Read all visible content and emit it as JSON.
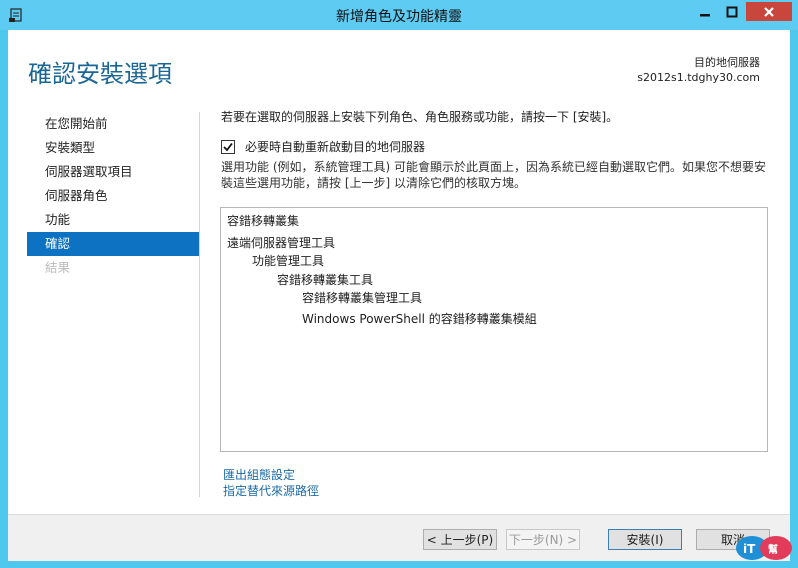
{
  "window": {
    "title": "新增角色及功能精靈"
  },
  "header": {
    "page_title": "確認安裝選項",
    "dest_label": "目的地伺服器",
    "dest_server": "s2012s1.tdghy30.com"
  },
  "sidebar": {
    "items": [
      {
        "label": "在您開始前"
      },
      {
        "label": "安裝類型"
      },
      {
        "label": "伺服器選取項目"
      },
      {
        "label": "伺服器角色"
      },
      {
        "label": "功能"
      },
      {
        "label": "確認"
      },
      {
        "label": "結果"
      }
    ]
  },
  "main": {
    "intro": "若要在選取的伺服器上安裝下列角色、角色服務或功能，請按一下 [安裝]。",
    "restart_label": "必要時自動重新啟動目的地伺服器",
    "restart_checked": true,
    "note": "選用功能 (例如，系統管理工具) 可能會顯示於此頁面上，因為系統已經自動選取它們。如果您不想要安裝這些選用功能，請按 [上一步] 以清除它們的核取方塊。",
    "features": [
      "容錯移轉叢集",
      "遠端伺服器管理工具",
      "功能管理工具",
      "容錯移轉叢集工具",
      "容錯移轉叢集管理工具",
      "Windows PowerShell 的容錯移轉叢集模組"
    ],
    "export_link": "匯出組態設定",
    "alt_source_link": "指定替代來源路徑"
  },
  "footer": {
    "prev": "< 上一步(P)",
    "next": "下一步(N) >",
    "install": "安裝(I)",
    "cancel": "取消"
  },
  "colors": {
    "titlebar": "#5ecbf2",
    "accent": "#0d72c2",
    "title_text": "#1a6694",
    "link": "#1a6aa8",
    "close": "#c9463d"
  }
}
